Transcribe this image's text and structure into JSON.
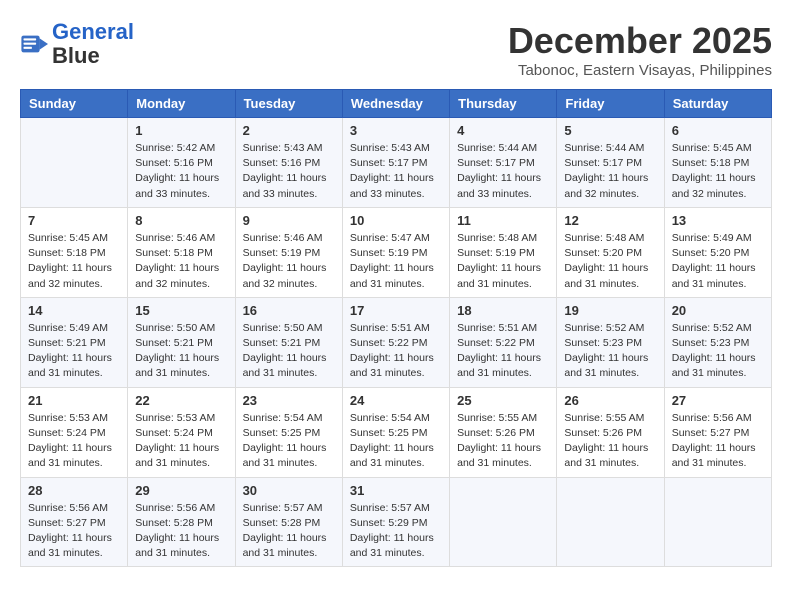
{
  "header": {
    "logo_line1": "General",
    "logo_line2": "Blue",
    "month_year": "December 2025",
    "location": "Tabonoc, Eastern Visayas, Philippines"
  },
  "weekdays": [
    "Sunday",
    "Monday",
    "Tuesday",
    "Wednesday",
    "Thursday",
    "Friday",
    "Saturday"
  ],
  "weeks": [
    [
      {
        "day": "",
        "info": ""
      },
      {
        "day": "1",
        "info": "Sunrise: 5:42 AM\nSunset: 5:16 PM\nDaylight: 11 hours\nand 33 minutes."
      },
      {
        "day": "2",
        "info": "Sunrise: 5:43 AM\nSunset: 5:16 PM\nDaylight: 11 hours\nand 33 minutes."
      },
      {
        "day": "3",
        "info": "Sunrise: 5:43 AM\nSunset: 5:17 PM\nDaylight: 11 hours\nand 33 minutes."
      },
      {
        "day": "4",
        "info": "Sunrise: 5:44 AM\nSunset: 5:17 PM\nDaylight: 11 hours\nand 33 minutes."
      },
      {
        "day": "5",
        "info": "Sunrise: 5:44 AM\nSunset: 5:17 PM\nDaylight: 11 hours\nand 32 minutes."
      },
      {
        "day": "6",
        "info": "Sunrise: 5:45 AM\nSunset: 5:18 PM\nDaylight: 11 hours\nand 32 minutes."
      }
    ],
    [
      {
        "day": "7",
        "info": "Sunrise: 5:45 AM\nSunset: 5:18 PM\nDaylight: 11 hours\nand 32 minutes."
      },
      {
        "day": "8",
        "info": "Sunrise: 5:46 AM\nSunset: 5:18 PM\nDaylight: 11 hours\nand 32 minutes."
      },
      {
        "day": "9",
        "info": "Sunrise: 5:46 AM\nSunset: 5:19 PM\nDaylight: 11 hours\nand 32 minutes."
      },
      {
        "day": "10",
        "info": "Sunrise: 5:47 AM\nSunset: 5:19 PM\nDaylight: 11 hours\nand 31 minutes."
      },
      {
        "day": "11",
        "info": "Sunrise: 5:48 AM\nSunset: 5:19 PM\nDaylight: 11 hours\nand 31 minutes."
      },
      {
        "day": "12",
        "info": "Sunrise: 5:48 AM\nSunset: 5:20 PM\nDaylight: 11 hours\nand 31 minutes."
      },
      {
        "day": "13",
        "info": "Sunrise: 5:49 AM\nSunset: 5:20 PM\nDaylight: 11 hours\nand 31 minutes."
      }
    ],
    [
      {
        "day": "14",
        "info": "Sunrise: 5:49 AM\nSunset: 5:21 PM\nDaylight: 11 hours\nand 31 minutes."
      },
      {
        "day": "15",
        "info": "Sunrise: 5:50 AM\nSunset: 5:21 PM\nDaylight: 11 hours\nand 31 minutes."
      },
      {
        "day": "16",
        "info": "Sunrise: 5:50 AM\nSunset: 5:21 PM\nDaylight: 11 hours\nand 31 minutes."
      },
      {
        "day": "17",
        "info": "Sunrise: 5:51 AM\nSunset: 5:22 PM\nDaylight: 11 hours\nand 31 minutes."
      },
      {
        "day": "18",
        "info": "Sunrise: 5:51 AM\nSunset: 5:22 PM\nDaylight: 11 hours\nand 31 minutes."
      },
      {
        "day": "19",
        "info": "Sunrise: 5:52 AM\nSunset: 5:23 PM\nDaylight: 11 hours\nand 31 minutes."
      },
      {
        "day": "20",
        "info": "Sunrise: 5:52 AM\nSunset: 5:23 PM\nDaylight: 11 hours\nand 31 minutes."
      }
    ],
    [
      {
        "day": "21",
        "info": "Sunrise: 5:53 AM\nSunset: 5:24 PM\nDaylight: 11 hours\nand 31 minutes."
      },
      {
        "day": "22",
        "info": "Sunrise: 5:53 AM\nSunset: 5:24 PM\nDaylight: 11 hours\nand 31 minutes."
      },
      {
        "day": "23",
        "info": "Sunrise: 5:54 AM\nSunset: 5:25 PM\nDaylight: 11 hours\nand 31 minutes."
      },
      {
        "day": "24",
        "info": "Sunrise: 5:54 AM\nSunset: 5:25 PM\nDaylight: 11 hours\nand 31 minutes."
      },
      {
        "day": "25",
        "info": "Sunrise: 5:55 AM\nSunset: 5:26 PM\nDaylight: 11 hours\nand 31 minutes."
      },
      {
        "day": "26",
        "info": "Sunrise: 5:55 AM\nSunset: 5:26 PM\nDaylight: 11 hours\nand 31 minutes."
      },
      {
        "day": "27",
        "info": "Sunrise: 5:56 AM\nSunset: 5:27 PM\nDaylight: 11 hours\nand 31 minutes."
      }
    ],
    [
      {
        "day": "28",
        "info": "Sunrise: 5:56 AM\nSunset: 5:27 PM\nDaylight: 11 hours\nand 31 minutes."
      },
      {
        "day": "29",
        "info": "Sunrise: 5:56 AM\nSunset: 5:28 PM\nDaylight: 11 hours\nand 31 minutes."
      },
      {
        "day": "30",
        "info": "Sunrise: 5:57 AM\nSunset: 5:28 PM\nDaylight: 11 hours\nand 31 minutes."
      },
      {
        "day": "31",
        "info": "Sunrise: 5:57 AM\nSunset: 5:29 PM\nDaylight: 11 hours\nand 31 minutes."
      },
      {
        "day": "",
        "info": ""
      },
      {
        "day": "",
        "info": ""
      },
      {
        "day": "",
        "info": ""
      }
    ]
  ]
}
